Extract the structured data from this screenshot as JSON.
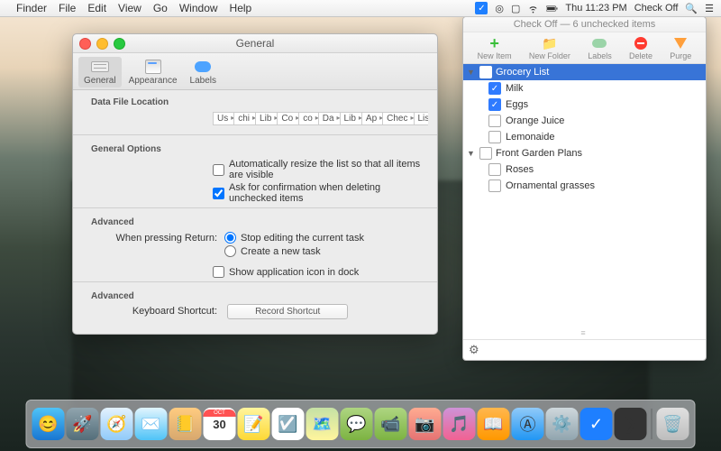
{
  "menubar": {
    "app": "Finder",
    "items": [
      "File",
      "Edit",
      "View",
      "Go",
      "Window",
      "Help"
    ],
    "clock": "Thu 11:23 PM",
    "right_app": "Check Off"
  },
  "prefs": {
    "title": "General",
    "tabs": {
      "general": "General",
      "appearance": "Appearance",
      "labels": "Labels"
    },
    "sections": {
      "data_loc": "Data File Location",
      "general_opts": "General Options",
      "advanced": "Advanced",
      "advanced2": "Advanced"
    },
    "breadcrumb": [
      "Us",
      "chi",
      "Lib",
      "Co",
      "co",
      "Da",
      "Lib",
      "Ap",
      "Chec",
      "ListData.checkoff"
    ],
    "auto_resize": "Automatically resize the list so that all items are visible",
    "ask_confirm": "Ask for confirmation when deleting unchecked items",
    "return_label": "When pressing Return:",
    "return_stop": "Stop editing the current task",
    "return_new": "Create a new task",
    "show_dock": "Show application icon in dock",
    "shortcut_label": "Keyboard Shortcut:",
    "shortcut_btn": "Record Shortcut"
  },
  "panel": {
    "title": "Check Off — 6 unchecked items",
    "toolbar": {
      "new_item": "New Item",
      "new_folder": "New Folder",
      "labels": "Labels",
      "delete": "Delete",
      "purge": "Purge"
    },
    "groups": [
      {
        "name": "Grocery List",
        "selected": true,
        "items": [
          {
            "name": "Milk",
            "checked": true
          },
          {
            "name": "Eggs",
            "checked": true
          },
          {
            "name": "Orange Juice",
            "checked": false
          },
          {
            "name": "Lemonaide",
            "checked": false
          }
        ]
      },
      {
        "name": "Front Garden Plans",
        "selected": false,
        "items": [
          {
            "name": "Roses",
            "checked": false
          },
          {
            "name": "Ornamental grasses",
            "checked": false
          }
        ]
      }
    ]
  },
  "dock": {
    "cal_month": "OCT",
    "cal_day": "30"
  }
}
